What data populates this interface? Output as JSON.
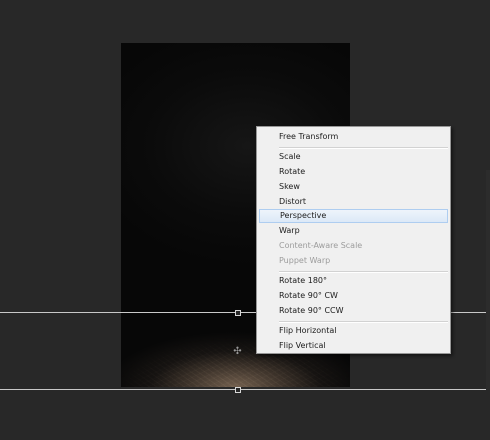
{
  "context_menu": {
    "items": [
      {
        "label": "Free Transform",
        "enabled": true,
        "highlighted": false
      },
      {
        "label": "Scale",
        "enabled": true,
        "highlighted": false
      },
      {
        "label": "Rotate",
        "enabled": true,
        "highlighted": false
      },
      {
        "label": "Skew",
        "enabled": true,
        "highlighted": false
      },
      {
        "label": "Distort",
        "enabled": true,
        "highlighted": false
      },
      {
        "label": "Perspective",
        "enabled": true,
        "highlighted": true
      },
      {
        "label": "Warp",
        "enabled": true,
        "highlighted": false
      },
      {
        "label": "Content-Aware Scale",
        "enabled": false,
        "highlighted": false
      },
      {
        "label": "Puppet Warp",
        "enabled": false,
        "highlighted": false
      },
      {
        "label": "Rotate 180°",
        "enabled": true,
        "highlighted": false
      },
      {
        "label": "Rotate 90° CW",
        "enabled": true,
        "highlighted": false
      },
      {
        "label": "Rotate 90° CCW",
        "enabled": true,
        "highlighted": false
      },
      {
        "label": "Flip Horizontal",
        "enabled": true,
        "highlighted": false
      },
      {
        "label": "Flip Vertical",
        "enabled": true,
        "highlighted": false
      }
    ]
  },
  "colors": {
    "workspace_bg": "#282828",
    "menu_bg": "#f0f0f0",
    "menu_highlight": "#dce9f7",
    "disabled_text": "#9c9c9c",
    "transform_line": "#c9c9c9"
  }
}
